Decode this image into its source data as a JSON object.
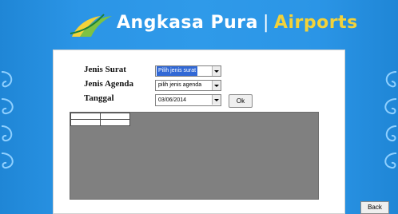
{
  "header": {
    "brand_name": "Angkasa Pura",
    "separator": "|",
    "brand_suffix": "Airports",
    "suffix_color": "#f3d23a"
  },
  "form": {
    "jenis_surat_label": "Jenis Surat",
    "jenis_surat_value": "Pilih jenis surat",
    "jenis_agenda_label": "Jenis Agenda",
    "jenis_agenda_value": "pilih jenis agenda",
    "tanggal_label": "Tanggal",
    "tanggal_value": "03/06/2014",
    "ok_label": "Ok"
  },
  "footer": {
    "back_label": "Back"
  },
  "icons": [
    "logo-swoosh-icon",
    "swirl-ornament-icon",
    "chevron-down-icon"
  ]
}
